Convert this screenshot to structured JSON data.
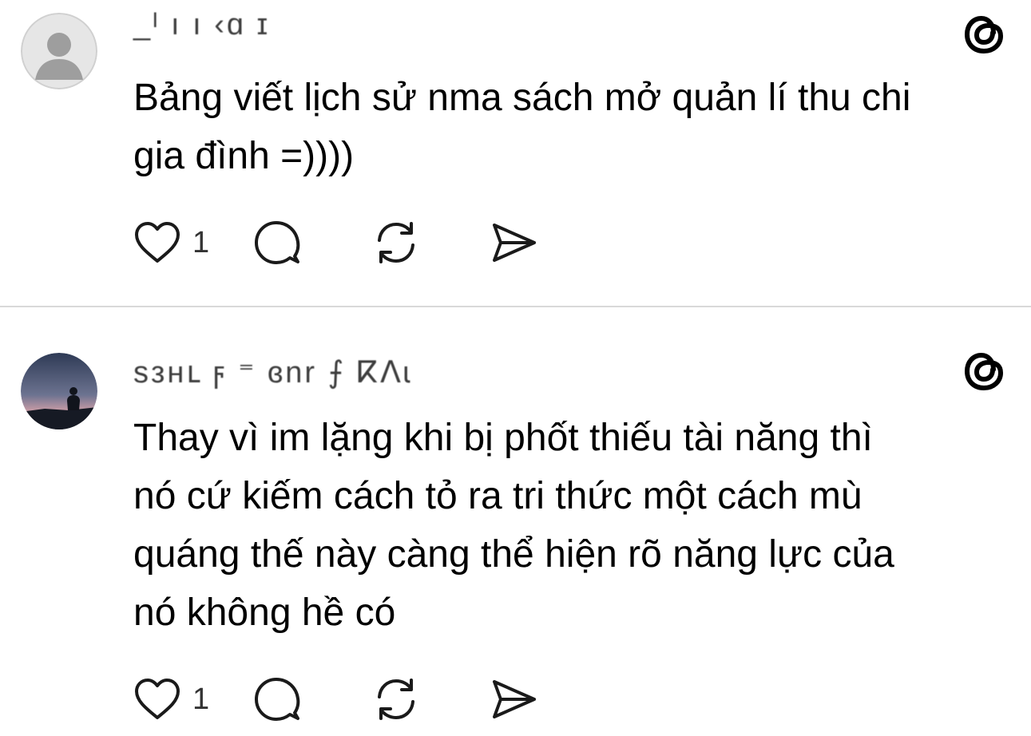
{
  "posts": [
    {
      "username": "_ᴵ ı      ı ‹ɑ ɪ",
      "text_lines": [
        "Bảng viết lịch sử nma sách mở quản lí thu chi",
        "gia đình =))))"
      ],
      "likes": "1",
      "avatar": "default-avatar",
      "logo": "threads-logo-icon"
    },
    {
      "username": "ѕзнւ ϝ ⁼ ɞnr ⨍     ⴽⴷɩ",
      "text_lines": [
        "Thay vì im lặng khi bị phốt thiếu tài năng thì",
        "nó cứ kiếm cách tỏ ra tri thức một cách mù",
        "quáng thế này càng thể hiện rõ năng lực của",
        "nó không hề có"
      ],
      "likes": "1",
      "avatar": "silhouette-sunset-avatar",
      "logo": "threads-logo-icon"
    }
  ],
  "colors": {
    "text": "#000000",
    "divider": "#d9d9d9",
    "icon": "#1a1a1a",
    "avatar_default_bg": "#d9d9d9",
    "avatar_default_fg": "#999999"
  }
}
